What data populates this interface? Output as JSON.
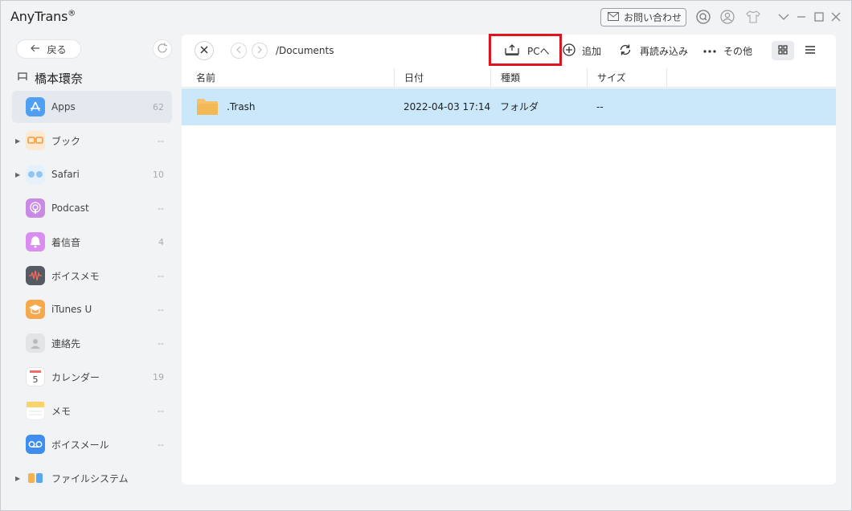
{
  "app": {
    "title": "AnyTrans",
    "title_mark": "®",
    "contact_label": "お問い合わせ"
  },
  "sidebar": {
    "back_label": "戻る",
    "device_name": "橋本環奈",
    "items": [
      {
        "label": "Apps",
        "count": "62",
        "icon": "apps-icon",
        "has_arrow": false,
        "active": true
      },
      {
        "label": "ブック",
        "count": "--",
        "icon": "book-icon",
        "has_arrow": true,
        "active": false
      },
      {
        "label": "Safari",
        "count": "10",
        "icon": "safari-icon",
        "has_arrow": true,
        "active": false
      },
      {
        "label": "Podcast",
        "count": "--",
        "icon": "podcast-icon",
        "has_arrow": false,
        "active": false
      },
      {
        "label": "着信音",
        "count": "4",
        "icon": "ringtone-icon",
        "has_arrow": false,
        "active": false
      },
      {
        "label": "ボイスメモ",
        "count": "--",
        "icon": "voice-memo-icon",
        "has_arrow": false,
        "active": false
      },
      {
        "label": "iTunes U",
        "count": "--",
        "icon": "itunes-u-icon",
        "has_arrow": false,
        "active": false
      },
      {
        "label": "連絡先",
        "count": "--",
        "icon": "contacts-icon",
        "has_arrow": false,
        "active": false
      },
      {
        "label": "カレンダー",
        "count": "19",
        "icon": "calendar-icon",
        "has_arrow": false,
        "active": false
      },
      {
        "label": "メモ",
        "count": "--",
        "icon": "notes-icon",
        "has_arrow": false,
        "active": false
      },
      {
        "label": "ボイスメール",
        "count": "--",
        "icon": "voicemail-icon",
        "has_arrow": false,
        "active": false
      },
      {
        "label": "ファイルシステム",
        "count": "",
        "icon": "file-system-icon",
        "has_arrow": true,
        "active": false
      }
    ]
  },
  "toolbar": {
    "path": "/Documents",
    "to_pc_label": "PCへ",
    "add_label": "追加",
    "reload_label": "再読み込み",
    "more_label": "その他"
  },
  "table": {
    "columns": [
      "名前",
      "日付",
      "種類",
      "サイズ"
    ],
    "rows": [
      {
        "name": ".Trash",
        "date": "2022-04-03 17:14",
        "type": "フォルダ",
        "size": "--"
      }
    ]
  },
  "colors": {
    "highlight": "#e0141e",
    "selected_row": "#cbe8fb",
    "folder": "#f5c26b"
  }
}
